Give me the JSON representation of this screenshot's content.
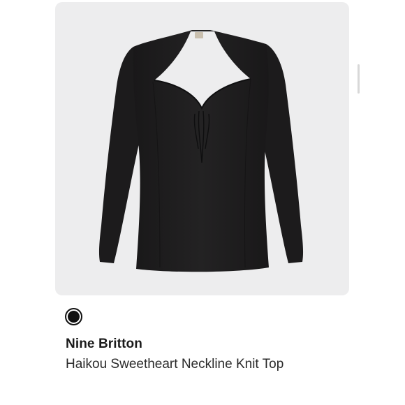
{
  "product": {
    "brand": "Nine Britton",
    "title": "Haikou Sweetheart Neckline Knit Top",
    "image": {
      "subject": "garment-photo",
      "background": "#ededee",
      "garment_color": "#1e1d1e"
    },
    "swatches": [
      {
        "color": "#111111",
        "selected": true
      }
    ],
    "more_icon": "more-horizontal-icon",
    "accent": "#1a1f6e"
  }
}
